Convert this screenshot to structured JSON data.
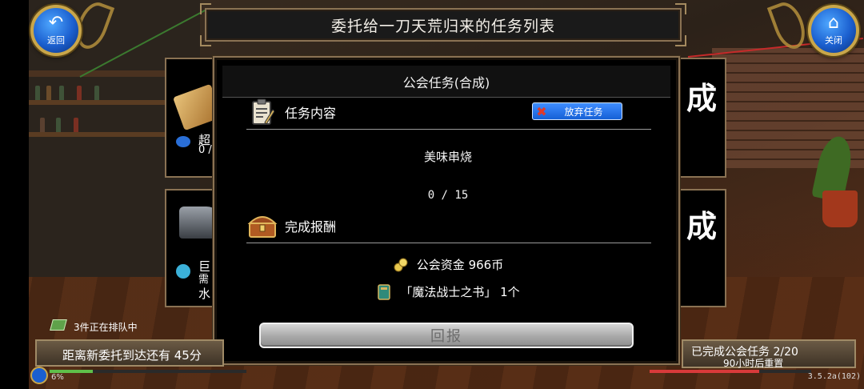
{
  "window": {
    "title": "委托给一刀天荒归来的任务列表"
  },
  "nav": {
    "back_label": "返回",
    "close_label": "关闭",
    "back_icon": "return-arrow-icon",
    "close_icon": "home-icon"
  },
  "bg_cards": {
    "card1_suffix": "成",
    "card1_text_line1": "超",
    "card1_text_line2": "0 /",
    "card2_suffix": "成",
    "card2_text_line1": "巨",
    "card2_text_line2": "需",
    "card2_text_line3": "水"
  },
  "modal": {
    "header": "公会任务(合成)",
    "task_section_label": "任务内容",
    "abandon_label": "放弃任务",
    "task_item": "美味串烧",
    "task_progress": "0 / 15",
    "reward_section_label": "完成报酬",
    "rewards": [
      {
        "icon": "coin-icon",
        "label": "公会资金 966币"
      },
      {
        "icon": "book-icon",
        "label": "「魔法战士之书」 1个"
      }
    ],
    "report_label": "回报"
  },
  "status": {
    "queue_text": "3件正在排队中",
    "next_commission": "距离新委托到达还有 45分",
    "left_percent": "6%",
    "completed_tasks": "已完成公会任务  2/20",
    "reset_text": "90小时后重置",
    "version": "3.5.2a(102)"
  },
  "colors": {
    "frame": "#8a7253",
    "accent_blue": "#1560d6",
    "gold": "#c9a64a"
  }
}
